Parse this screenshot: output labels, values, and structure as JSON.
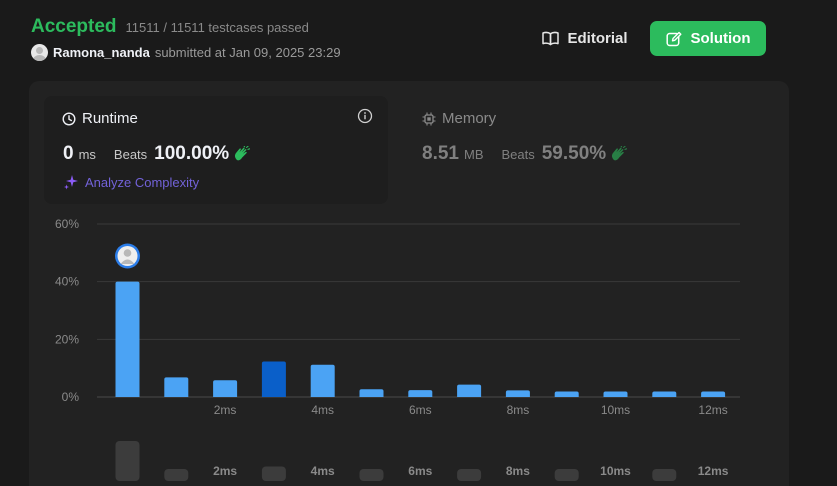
{
  "submission": {
    "status": "Accepted",
    "testcases": "11511 / 11511 testcases passed",
    "username": "Ramona_nanda",
    "submitted_text": "submitted at Jan 09, 2025 23:29"
  },
  "actions": {
    "editorial_label": "Editorial",
    "solution_label": "Solution"
  },
  "runtime": {
    "title": "Runtime",
    "value": "0",
    "unit": "ms",
    "beats_label": "Beats",
    "beats_value": "100.00%",
    "analyze_label": "Analyze Complexity"
  },
  "memory": {
    "title": "Memory",
    "value": "8.51",
    "unit": "MB",
    "beats_label": "Beats",
    "beats_value": "59.50%"
  },
  "colors": {
    "accepted": "#2cbb5d",
    "bar": "#4ba3f4",
    "bar_highlight": "#0a5fc9",
    "accent_purple": "#7262d8",
    "ghost_bar": "#3c3c3c"
  },
  "chart_data": {
    "type": "bar",
    "ylabel": "",
    "xlabel": "",
    "ylim": [
      0,
      60
    ],
    "yticks": [
      0,
      20,
      40,
      60
    ],
    "ytick_labels": [
      "0%",
      "20%",
      "40%",
      "60%"
    ],
    "x": [
      0,
      1,
      2,
      3,
      4,
      5,
      6,
      7,
      8,
      9,
      10,
      11,
      12
    ],
    "values": [
      40,
      6.8,
      5.8,
      12.3,
      11.2,
      2.7,
      2.4,
      4.3,
      2.3,
      1.9,
      1.9,
      1.9,
      1.9
    ],
    "highlight_index": 3,
    "xtick_labels": [
      "2ms",
      "4ms",
      "6ms",
      "8ms",
      "10ms",
      "12ms"
    ],
    "xtick_positions": [
      2,
      4,
      6,
      8,
      10,
      12
    ],
    "user_marker_index": 0,
    "minimap_values": [
      12,
      2,
      0,
      3,
      0,
      2,
      0,
      2,
      0,
      2,
      0,
      2,
      0
    ],
    "minimap_tick_labels": [
      "2ms",
      "4ms",
      "6ms",
      "8ms",
      "10ms",
      "12ms"
    ]
  }
}
